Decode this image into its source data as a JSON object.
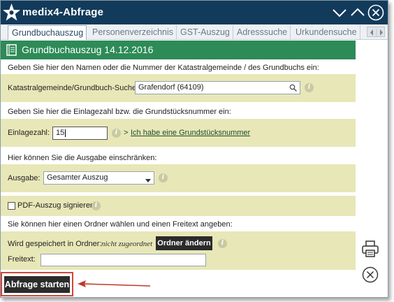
{
  "window": {
    "title": "medix4-Abfrage",
    "logo_icon": "star-logo-icon"
  },
  "titlebar_buttons": {
    "minimize_icon": "chevron-down-icon",
    "maximize_icon": "chevron-up-icon",
    "close_icon": "close-circle-icon"
  },
  "tabs": [
    {
      "label": "Grundbuchauszug",
      "active": true
    },
    {
      "label": "Personenverzeichnis",
      "active": false
    },
    {
      "label": "GST-Auszug",
      "active": false
    },
    {
      "label": "Adresssuche",
      "active": false
    },
    {
      "label": "Urkundensuche",
      "active": false
    }
  ],
  "section": {
    "title": "Grundbuchauszug 14.12.2016",
    "icon": "book-icon"
  },
  "katastral": {
    "instruction": "Geben Sie hier den Namen oder die Nummer der Katastralgemeinde / des Grundbuchs ein:",
    "label": "Katastralgemeinde/Grundbuch-Suche:",
    "value": "Grafendorf (64109)"
  },
  "einlage": {
    "instruction": "Geben Sie hier die Einlagezahl bzw. die Grundstücksnummer ein:",
    "label": "Einlagezahl:",
    "value": "15",
    "link_prefix": ">",
    "link_text": "Ich habe eine Grundstücksnummer"
  },
  "ausgabe": {
    "instruction": "Hier können Sie die Ausgabe einschränken:",
    "label": "Ausgabe:",
    "selected": "Gesamter Auszug"
  },
  "pdf": {
    "label": "PDF-Auszug signieren",
    "checked": false
  },
  "ordner": {
    "instruction": "Sie können hier einen Ordner wählen und einen Freitext angeben:",
    "label": "Wird gespeichert in Ordner:",
    "value": "nicht zugeordnet",
    "button": "Ordner ändern",
    "freitext_label": "Freitext:",
    "freitext_value": ""
  },
  "submit": {
    "label": "Abfrage starten"
  },
  "side_icons": {
    "print": "printer-icon",
    "close": "close-circle-icon"
  },
  "colors": {
    "titlebar": "#123a5b",
    "section_header": "#2d8b57",
    "band": "#e8e7b8",
    "highlight": "#d0473a"
  }
}
